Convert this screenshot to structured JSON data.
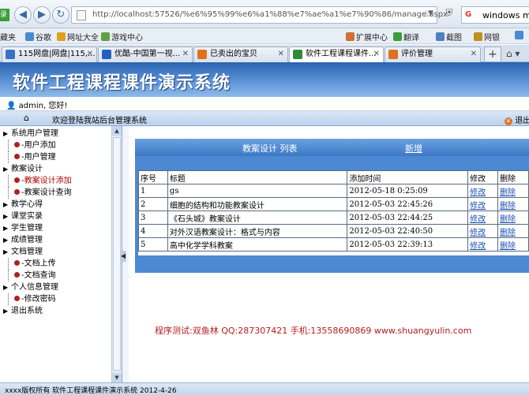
{
  "browser": {
    "login_tab": "录",
    "back_glyph": "◀",
    "forward_glyph": "▶",
    "reload_glyph": "↻",
    "url": "http://localhost:57526/%e6%95%99%e6%a1%88%e7%ae%a1%e7%90%86/manage.aspx",
    "search_text": "windows med",
    "search_g": "G"
  },
  "bookmarks": [
    {
      "label": "藏夹",
      "color": "#e8c040"
    },
    {
      "label": "谷歌",
      "color": "#4a8ad0"
    },
    {
      "label": "网址大全",
      "color": "#e0a020"
    },
    {
      "label": "游戏中心",
      "color": "#60a040"
    },
    {
      "label": "扩展中心",
      "color": "#d07030"
    },
    {
      "label": "翻译",
      "color": "#3a9d3a"
    },
    {
      "label": "截图",
      "color": "#5080c0"
    },
    {
      "label": "网银",
      "color": "#c09020"
    },
    {
      "label": "",
      "color": "#4a8ad0"
    }
  ],
  "tabs": [
    {
      "label": "115网盘|网盘|115,...",
      "color": "#3a70c0",
      "active": false
    },
    {
      "label": "优酷-中国第一视...",
      "color": "#2060c0",
      "active": false
    },
    {
      "label": "已卖出的宝贝",
      "color": "#e07020",
      "active": false
    },
    {
      "label": "软件工程课程课件...",
      "color": "#2f8a3a",
      "active": true
    },
    {
      "label": "评价管理",
      "color": "#e07020",
      "active": false
    }
  ],
  "newtab_glyph": "+",
  "home_glyph": "⌂ ▾",
  "site": {
    "title": "软件工程课程课件演示系统",
    "user_greeting": "admin, 您好!",
    "welcome": "欢迎登陆我站后台管理系统",
    "logout_top": "退出"
  },
  "tree": [
    {
      "label": "系统用户管理",
      "level": 0
    },
    {
      "label": "用户添加",
      "level": 1,
      "red": false
    },
    {
      "label": "用户管理",
      "level": 1,
      "red": false
    },
    {
      "label": "教案设计",
      "level": 0
    },
    {
      "label": "教案设计添加",
      "level": 1,
      "red": true
    },
    {
      "label": "教案设计查询",
      "level": 1,
      "red": false
    },
    {
      "label": "教学心得",
      "level": 0
    },
    {
      "label": "课堂实录",
      "level": 0
    },
    {
      "label": "学生管理",
      "level": 0
    },
    {
      "label": "成绩管理",
      "level": 0
    },
    {
      "label": "文档管理",
      "level": 0
    },
    {
      "label": "文档上传",
      "level": 1,
      "red": false
    },
    {
      "label": "文档查询",
      "level": 1,
      "red": false
    },
    {
      "label": "个人信息管理",
      "level": 0
    },
    {
      "label": "修改密码",
      "level": 1,
      "red": false
    },
    {
      "label": "退出系统",
      "level": 0
    }
  ],
  "panel": {
    "title": "教案设计  列表",
    "add_label": "新增"
  },
  "table": {
    "headers": [
      "序号",
      "标题",
      "添加时间",
      "修改",
      "删除"
    ],
    "rows": [
      {
        "no": "1",
        "title": "gs",
        "time": "2012-05-18 0:25:09",
        "edit": "修改",
        "del": "删除"
      },
      {
        "no": "2",
        "title": "细胞的结构和功能教案设计",
        "time": "2012-05-03 22:45:26",
        "edit": "修改",
        "del": "删除"
      },
      {
        "no": "3",
        "title": "《石头城》教案设计",
        "time": "2012-05-03 22:44:25",
        "edit": "修改",
        "del": "删除"
      },
      {
        "no": "4",
        "title": "对外汉语教案设计：格式与内容",
        "time": "2012-05-03 22:40:50",
        "edit": "修改",
        "del": "删除"
      },
      {
        "no": "5",
        "title": "高中化学学科教案",
        "time": "2012-05-03 22:39:13",
        "edit": "修改",
        "del": "删除"
      }
    ]
  },
  "footer": "程序测试:双鱼林 QQ:287307421 手机:13558690869 www.shuangyulin.com",
  "status": "xxxx版权所有  软件工程课程课件演示系统  2012-4-26"
}
